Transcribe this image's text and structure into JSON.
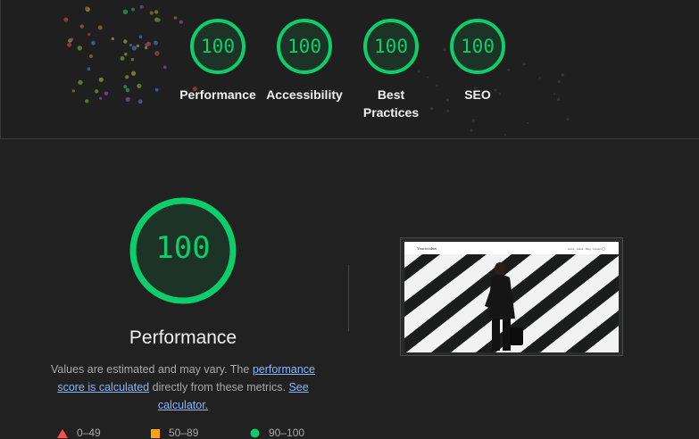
{
  "colors": {
    "pass": "#0cce6b",
    "average": "#ffa400",
    "fail": "#ff4e42",
    "link": "#8ab4f8"
  },
  "summary": {
    "categories": [
      {
        "label": "Performance",
        "score": "100"
      },
      {
        "label": "Accessibility",
        "score": "100"
      },
      {
        "label": "Best Practices",
        "score": "100"
      },
      {
        "label": "SEO",
        "score": "100"
      }
    ]
  },
  "performance": {
    "score": "100",
    "title": "Performance",
    "desc_text_1": "Values are estimated and may vary. The ",
    "desc_link_1": "performance score is calculated",
    "desc_text_2": " directly from these metrics. ",
    "desc_link_2": "See calculator."
  },
  "screenshot": {
    "site_name": "Yourfoodnet",
    "nav_items": [
      "Home",
      "About",
      "Blog",
      "Contact"
    ]
  },
  "legend": [
    {
      "range": "0–49",
      "shape": "triangle",
      "color": "#ff4e42"
    },
    {
      "range": "50–89",
      "shape": "square",
      "color": "#ffa400"
    },
    {
      "range": "90–100",
      "shape": "circle",
      "color": "#0cce6b"
    }
  ]
}
